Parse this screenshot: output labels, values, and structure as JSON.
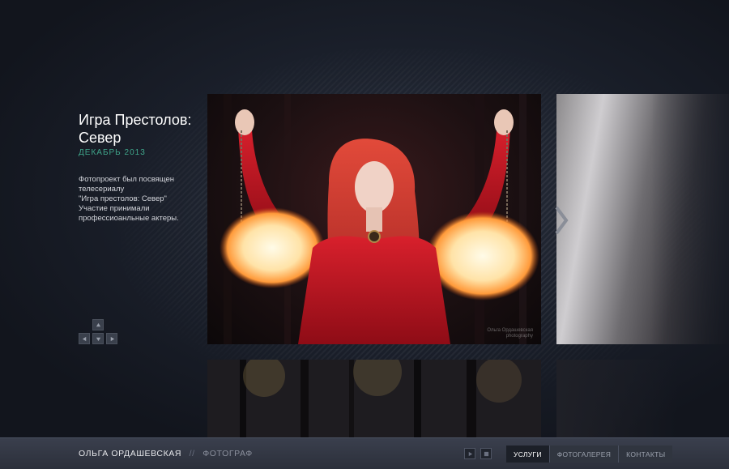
{
  "project": {
    "title": "Игра Престолов: Север",
    "date": "ДЕКАБРЬ 2013",
    "description": "Фотопроект был посвящен\nтелесериалу\n\"Игра престолов: Север\"\nУчастие принимали\nпрофессиоанльные актеры."
  },
  "photo": {
    "watermark": "Ольга Ордашевская\nphotography"
  },
  "footer": {
    "name": "ОЛЬГА ОРДАШЕВСКАЯ",
    "separator": "//",
    "role": "ФОТОГРАФ",
    "menu": [
      {
        "label": "УСЛУГИ",
        "active": true
      },
      {
        "label": "ФОТОГАЛЕРЕЯ",
        "active": false
      },
      {
        "label": "КОНТАКТЫ",
        "active": false
      }
    ]
  },
  "icons": {
    "nav": [
      "arrow-up-icon",
      "arrow-left-icon",
      "arrow-down-icon",
      "arrow-right-icon"
    ],
    "next": "chevron-right-icon",
    "player": [
      "play-icon",
      "stop-icon"
    ]
  },
  "colors": {
    "accent_date": "#3fa58a",
    "background": "#141821",
    "footer": "#33384a"
  }
}
